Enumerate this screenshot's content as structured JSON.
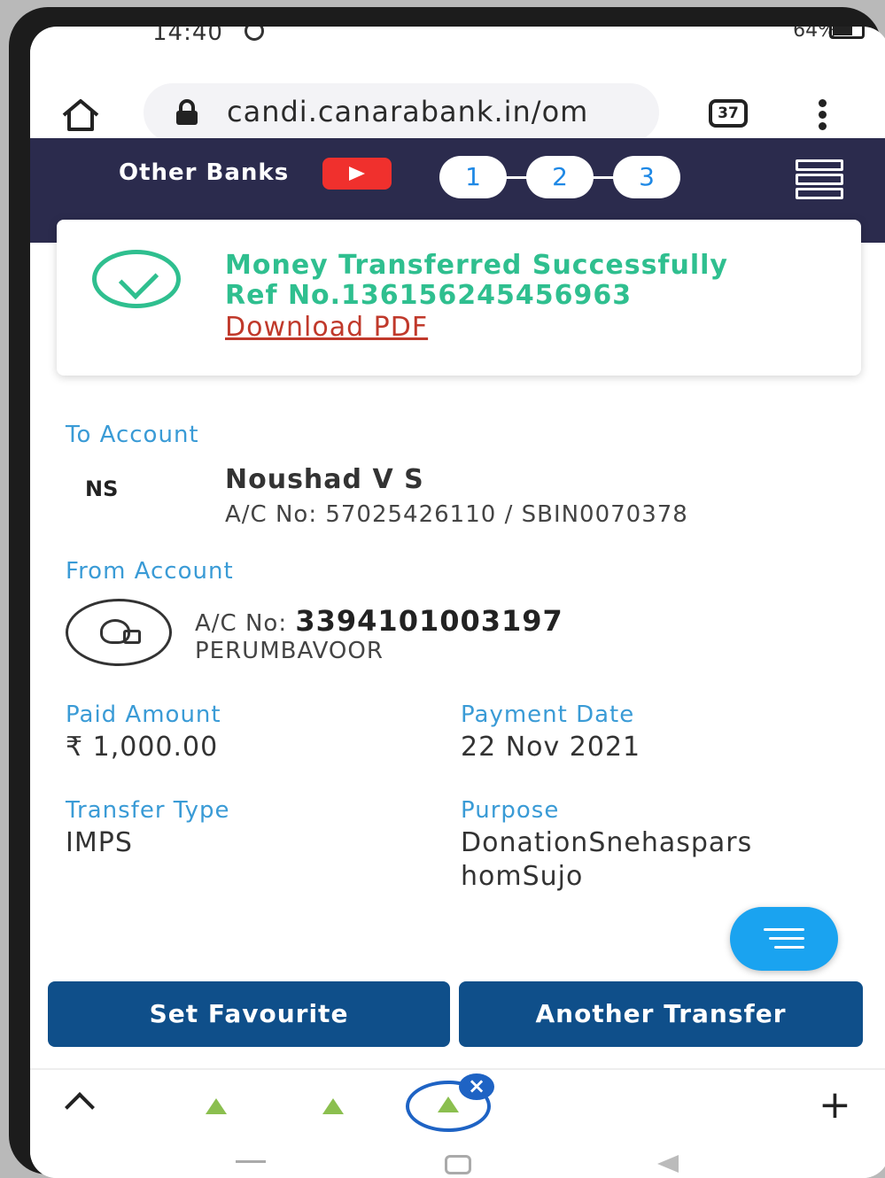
{
  "status_bar": {
    "time": "14:40",
    "battery": "64%"
  },
  "browser": {
    "url": "candi.canarabank.in/om",
    "tab_count": "37"
  },
  "header": {
    "title": "Other Banks",
    "steps": [
      "1",
      "2",
      "3"
    ]
  },
  "success": {
    "message": "Money Transferred Successfully",
    "ref": "Ref No.136156245456963",
    "download": "Download PDF"
  },
  "to_account": {
    "label": "To Account",
    "initials": "NS",
    "name": "Noushad V S",
    "details": "A/C No: 57025426110 / SBIN0070378"
  },
  "from_account": {
    "label": "From Account",
    "acc_prefix": "A/C No: ",
    "acc_number": "3394101003197",
    "branch": "PERUMBAVOOR"
  },
  "payment": {
    "paid_label": "Paid Amount",
    "paid_value": "₹ 1,000.00",
    "date_label": "Payment Date",
    "date_value": "22 Nov 2021",
    "type_label": "Transfer Type",
    "type_value": "IMPS",
    "purpose_label": "Purpose",
    "purpose_line1": "DonationSnehaspars",
    "purpose_line2": "homSujo"
  },
  "actions": {
    "favourite": "Set Favourite",
    "another": "Another Transfer"
  },
  "bottom_bar": {
    "close_badge": "×",
    "plus": "+"
  },
  "colors": {
    "header_bg": "#2b2b4d",
    "success": "#2fbf8f",
    "label": "#3a9bd6",
    "button": "#0f4f8a",
    "fab": "#1aa3f0"
  }
}
